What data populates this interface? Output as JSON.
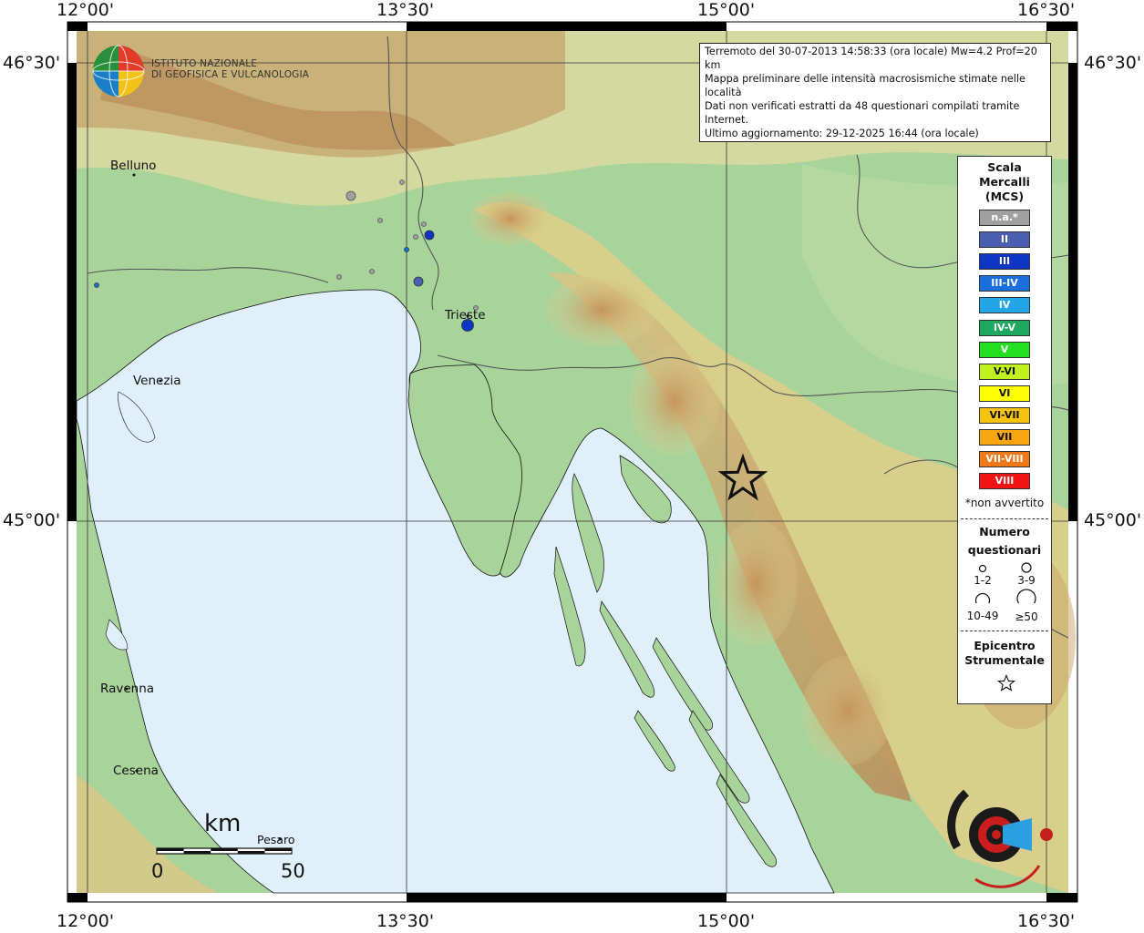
{
  "coordinates": {
    "top_left": "12°00'",
    "top_mid1": "13°30'",
    "top_mid2": "15°00'",
    "top_right": "16°30'",
    "bottom_left": "12°00'",
    "bottom_mid1": "13°30'",
    "bottom_mid2": "15°00'",
    "bottom_right": "16°30'",
    "left_top": "46°30'",
    "left_mid": "45°00'",
    "right_top": "46°30'",
    "right_mid": "45°00'"
  },
  "logo": {
    "line1": "ISTITUTO NAZIONALE",
    "line2": "DI GEOFISICA E VULCANOLOGIA"
  },
  "info": {
    "line1": "Terremoto del 30-07-2013 14:58:33 (ora locale) Mw=4.2 Prof=20 km",
    "line2": "Mappa preliminare delle intensità macrosismiche stimate nelle località",
    "line3": "Dati non verificati estratti da 48 questionari compilati tramite Internet.",
    "line4": "Ultimo aggiornamento: 29-12-2025 16:44 (ora locale)"
  },
  "legend": {
    "title1": "Scala",
    "title2": "Mercalli",
    "title3": "(MCS)",
    "classes": [
      {
        "label": "n.a.*",
        "color": "#a0a0a0"
      },
      {
        "label": "II",
        "color": "#4a5fb0"
      },
      {
        "label": "III",
        "color": "#0e35c4"
      },
      {
        "label": "III-IV",
        "color": "#1a6fdc"
      },
      {
        "label": "IV",
        "color": "#22a6e8"
      },
      {
        "label": "IV-V",
        "color": "#1ea95e"
      },
      {
        "label": "V",
        "color": "#22e020"
      },
      {
        "label": "V-VI",
        "color": "#bff21e"
      },
      {
        "label": "VI",
        "color": "#ffff00"
      },
      {
        "label": "VI-VII",
        "color": "#f6c40e"
      },
      {
        "label": "VII",
        "color": "#f6a60e"
      },
      {
        "label": "VII-VIII",
        "color": "#f07818"
      },
      {
        "label": "VIII",
        "color": "#f01414"
      }
    ],
    "not_felt": "*non avvertito",
    "count_title1": "Numero",
    "count_title2": "questionari",
    "size_1": "1-2",
    "size_2": "3-9",
    "size_3": "10-49",
    "size_4": "≥50",
    "epic_title1": "Epicentro",
    "epic_title2": "Strumentale"
  },
  "cities": {
    "belluno": "Belluno",
    "venezia": "Venezia",
    "trieste": "Trieste",
    "ravenna": "Ravenna",
    "cesena": "Cesena",
    "pesaro": "Pesaro"
  },
  "scale_bar": {
    "unit": "km",
    "start": "0",
    "end": "50"
  },
  "colors": {
    "sea": "#dff0fa",
    "land_low": "#a9d39a",
    "land_mid": "#e0d89a",
    "land_high": "#c9a169",
    "star": "#111111"
  },
  "brand_logo": "www.haisentitoilterremoto.it"
}
